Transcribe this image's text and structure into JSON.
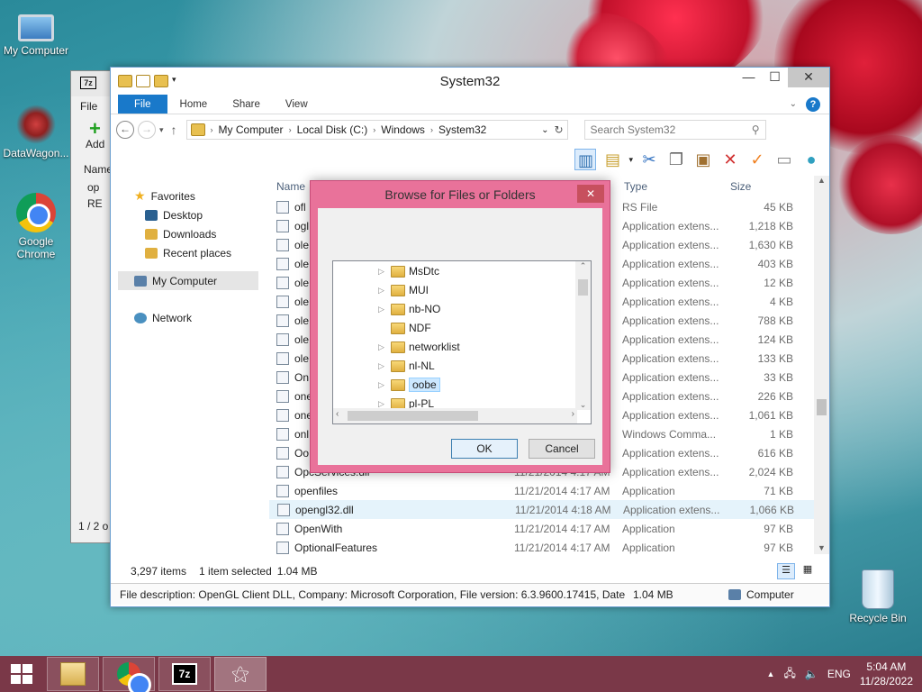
{
  "desktop": {
    "icons": [
      {
        "label": "My Computer"
      },
      {
        "label": "DataWagon..."
      },
      {
        "label": "Google Chrome"
      },
      {
        "label": "Recycle Bin"
      }
    ]
  },
  "zip_window": {
    "menu_file": "File",
    "add_label": "Add",
    "col_name": "Name",
    "rows": [
      "op",
      "RE"
    ],
    "status": "1 / 2 o"
  },
  "explorer": {
    "title": "System32",
    "ribbon_tabs": [
      "File",
      "Home",
      "Share",
      "View"
    ],
    "address_crumbs": [
      "My Computer",
      "Local Disk (C:)",
      "Windows",
      "System32"
    ],
    "search_placeholder": "Search System32",
    "nav": {
      "favorites": "Favorites",
      "fav_items": [
        "Desktop",
        "Downloads",
        "Recent places"
      ],
      "my_computer": "My Computer",
      "network": "Network"
    },
    "columns": {
      "name": "Name",
      "type": "Type",
      "size": "Size"
    },
    "files": [
      {
        "name": "ofl",
        "date": "",
        "type": "RS File",
        "size": "45 KB"
      },
      {
        "name": "ogl",
        "date": "",
        "type": "Application extens...",
        "size": "1,218 KB"
      },
      {
        "name": "ole",
        "date": "",
        "type": "Application extens...",
        "size": "1,630 KB"
      },
      {
        "name": "ole",
        "date": "",
        "type": "Application extens...",
        "size": "403 KB"
      },
      {
        "name": "ole",
        "date": "",
        "type": "Application extens...",
        "size": "12 KB"
      },
      {
        "name": "ole",
        "date": "",
        "type": "Application extens...",
        "size": "4 KB"
      },
      {
        "name": "ole",
        "date": "",
        "type": "Application extens...",
        "size": "788 KB"
      },
      {
        "name": "ole",
        "date": "",
        "type": "Application extens...",
        "size": "124 KB"
      },
      {
        "name": "ole",
        "date": "",
        "type": "Application extens...",
        "size": "133 KB"
      },
      {
        "name": "On",
        "date": "",
        "type": "Application extens...",
        "size": "33 KB"
      },
      {
        "name": "one",
        "date": "",
        "type": "Application extens...",
        "size": "226 KB"
      },
      {
        "name": "one",
        "date": "",
        "type": "Application extens...",
        "size": "1,061 KB"
      },
      {
        "name": "onl",
        "date": "",
        "type": "Windows Comma...",
        "size": "1 KB"
      },
      {
        "name": "Oo",
        "date": "",
        "type": "Application extens...",
        "size": "616 KB"
      },
      {
        "name": "OpcServices.dll",
        "date": "11/21/2014 4:17 AM",
        "type": "Application extens...",
        "size": "2,024 KB"
      },
      {
        "name": "openfiles",
        "date": "11/21/2014 4:17 AM",
        "type": "Application",
        "size": "71 KB"
      },
      {
        "name": "opengl32.dll",
        "date": "11/21/2014 4:18 AM",
        "type": "Application extens...",
        "size": "1,066 KB"
      },
      {
        "name": "OpenWith",
        "date": "11/21/2014 4:17 AM",
        "type": "Application",
        "size": "97 KB"
      },
      {
        "name": "OptionalFeatures",
        "date": "11/21/2014 4:17 AM",
        "type": "Application",
        "size": "97 KB"
      }
    ],
    "status": {
      "count": "3,297 items",
      "selected": "1 item selected",
      "size": "1.04 MB"
    },
    "details": {
      "description": "File description: OpenGL Client DLL, Company: Microsoft Corporation, File version: 6.3.9600.17415, Date",
      "size": "1.04 MB",
      "location": "Computer"
    }
  },
  "dialog": {
    "title": "Browse for Files or Folders",
    "tree_items": [
      {
        "label": "MsDtc",
        "expandable": true
      },
      {
        "label": "MUI",
        "expandable": true
      },
      {
        "label": "nb-NO",
        "expandable": true
      },
      {
        "label": "NDF",
        "expandable": false
      },
      {
        "label": "networklist",
        "expandable": true
      },
      {
        "label": "nl-NL",
        "expandable": true
      },
      {
        "label": "oobe",
        "expandable": true,
        "selected": true
      },
      {
        "label": "pl-PL",
        "expandable": true
      }
    ],
    "ok_label": "OK",
    "cancel_label": "Cancel"
  },
  "taskbar": {
    "language": "ENG",
    "time": "5:04 AM",
    "date": "11/28/2022"
  }
}
